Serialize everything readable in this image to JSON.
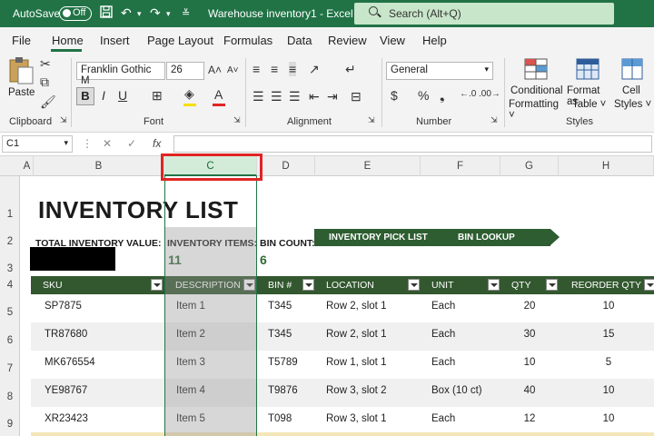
{
  "titlebar": {
    "autosave_label": "AutoSave",
    "autosave_state": "Off",
    "window_title": "Warehouse inventory1  -  Excel",
    "search_placeholder": "Search (Alt+Q)"
  },
  "menu": {
    "items": [
      "File",
      "Home",
      "Insert",
      "Page Layout",
      "Formulas",
      "Data",
      "Review",
      "View",
      "Help"
    ],
    "active": "Home"
  },
  "ribbon": {
    "clipboard": {
      "label": "Clipboard",
      "paste": "Paste"
    },
    "font": {
      "label": "Font",
      "font_name": "Franklin Gothic M",
      "font_size": "26"
    },
    "alignment": {
      "label": "Alignment"
    },
    "number": {
      "label": "Number",
      "format": "General"
    },
    "styles": {
      "label": "Styles",
      "conditional_formatting": [
        "Conditional",
        "Formatting ˅"
      ],
      "format_as_table": [
        "Format as",
        "Table ˅"
      ],
      "cell_styles": [
        "Cell",
        "Styles ˅"
      ]
    }
  },
  "formula_bar": {
    "name_box": "C1",
    "fx": "fx",
    "formula": ""
  },
  "grid": {
    "columns": [
      "A",
      "B",
      "C",
      "D",
      "E",
      "F",
      "G",
      "H"
    ],
    "selected_column": "C",
    "rows": [
      "1",
      "2",
      "3",
      "4",
      "5",
      "6",
      "7",
      "8",
      "9"
    ]
  },
  "sheet": {
    "title": "INVENTORY LIST",
    "total_value_label": "TOTAL INVENTORY VALUE:",
    "items_label": "INVENTORY ITEMS:",
    "items_value": "11",
    "bin_count_label": "BIN COUNT:",
    "bin_count_value": "6",
    "links": [
      "INVENTORY PICK LIST",
      "BIN LOOKUP"
    ],
    "headers": [
      "SKU",
      "DESCRIPTION",
      "BIN #",
      "LOCATION",
      "UNIT",
      "QTY",
      "REORDER QTY"
    ],
    "rows": [
      [
        "SP7875",
        "Item 1",
        "T345",
        "Row 2, slot 1",
        "Each",
        "20",
        "10"
      ],
      [
        "TR87680",
        "Item 2",
        "T345",
        "Row 2, slot 1",
        "Each",
        "30",
        "15"
      ],
      [
        "MK676554",
        "Item 3",
        "T5789",
        "Row 1, slot 1",
        "Each",
        "10",
        "5"
      ],
      [
        "YE98767",
        "Item 4",
        "T9876",
        "Row 3, slot 2",
        "Box (10 ct)",
        "40",
        "10"
      ],
      [
        "XR23423",
        "Item 5",
        "T098",
        "Row 3, slot 1",
        "Each",
        "12",
        "10"
      ]
    ]
  },
  "colors": {
    "excel_green": "#217346",
    "table_header": "#33582f",
    "highlight_red": "#e02424"
  }
}
